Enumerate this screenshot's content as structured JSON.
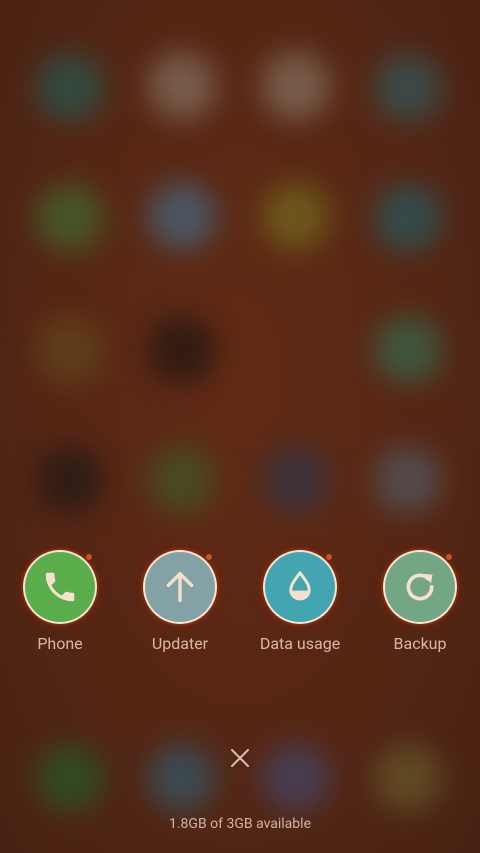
{
  "apps": [
    {
      "name": "phone",
      "label": "Phone",
      "icon": "phone-icon",
      "color": "#59ad4b"
    },
    {
      "name": "updater",
      "label": "Updater",
      "icon": "arrow-up-icon",
      "color": "#84a2a5"
    },
    {
      "name": "data-usage",
      "label": "Data usage",
      "icon": "water-drop-icon",
      "color": "#43a5b0"
    },
    {
      "name": "backup",
      "label": "Backup",
      "icon": "refresh-icon",
      "color": "#73a685"
    }
  ],
  "memory": {
    "status": "1.8GB of 3GB available"
  },
  "colors": {
    "background": "#5c2a16",
    "icon_glyph": "#f6e1cc",
    "label_text": "#d9b8a8"
  }
}
